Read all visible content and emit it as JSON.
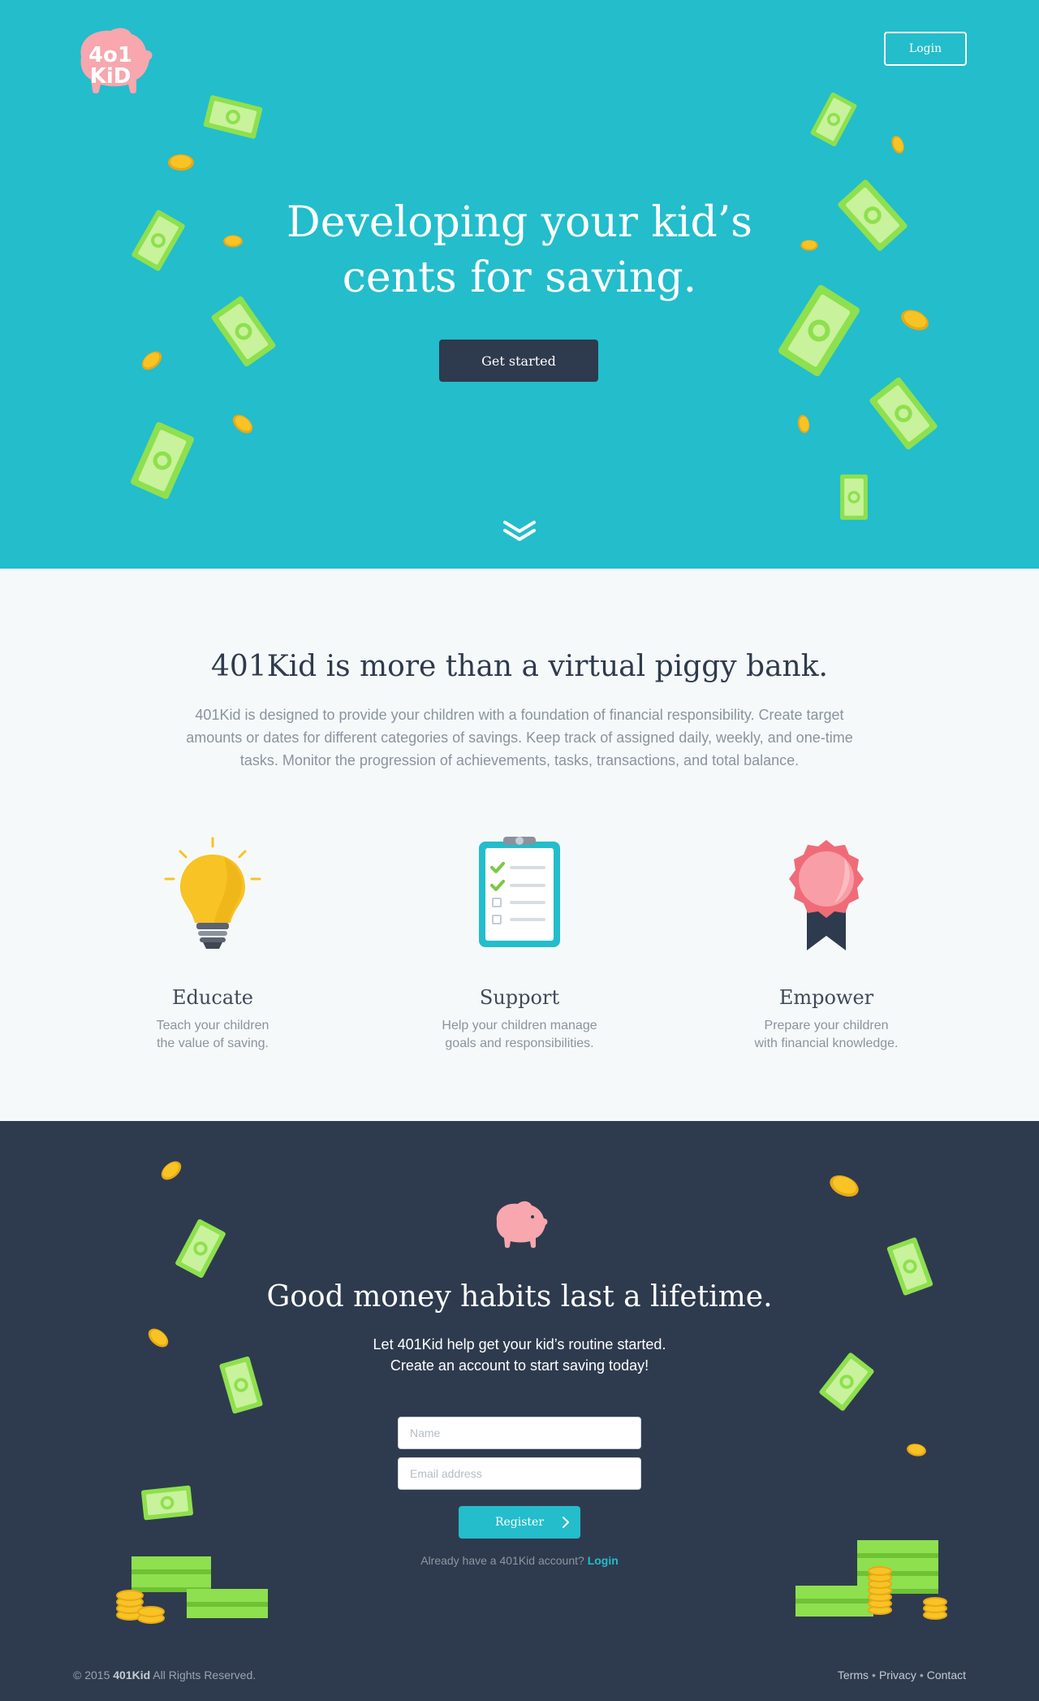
{
  "brand": {
    "logo_line1": "4o1",
    "logo_line2": "KiD"
  },
  "header": {
    "login_label": "Login"
  },
  "hero": {
    "title_line1": "Developing your kid’s",
    "title_line2": "cents for saving.",
    "cta_label": "Get started"
  },
  "features": {
    "title": "401Kid is more than a virtual piggy bank.",
    "description": "401Kid is designed to provide your children with a foundation of financial responsibility. Create target amounts or dates for different categories of savings. Keep track of assigned daily, weekly, and one-time tasks. Monitor the progression of achievements, tasks, transactions, and total balance.",
    "items": [
      {
        "icon": "lightbulb-icon",
        "title": "Educate",
        "text_line1": "Teach your children",
        "text_line2": "the value of saving."
      },
      {
        "icon": "clipboard-checklist-icon",
        "title": "Support",
        "text_line1": "Help your children manage",
        "text_line2": "goals and responsibilities."
      },
      {
        "icon": "award-ribbon-icon",
        "title": "Empower",
        "text_line1": "Prepare your children",
        "text_line2": "with financial knowledge."
      }
    ]
  },
  "signup": {
    "title": "Good money habits last a lifetime.",
    "sub_line1": "Let 401Kid help get your kid’s routine started.",
    "sub_line2": "Create an account to start saving today!",
    "name_placeholder": "Name",
    "email_placeholder": "Email address",
    "register_label": "Register",
    "already_text": "Already have a 401Kid account?",
    "login_link": "Login"
  },
  "footer": {
    "copyright_prefix": "© 2015",
    "brand": "401Kid",
    "copyright_suffix": "All Rights Reserved.",
    "links": [
      "Terms",
      "Privacy",
      "Contact"
    ]
  },
  "colors": {
    "hero_bg": "#23bdcc",
    "dark": "#2e3b4e",
    "light_bg": "#f6f9fa",
    "bill_green": "#8ee04e",
    "coin_gold": "#f7c325",
    "piggy_pink": "#f7a7ad"
  }
}
